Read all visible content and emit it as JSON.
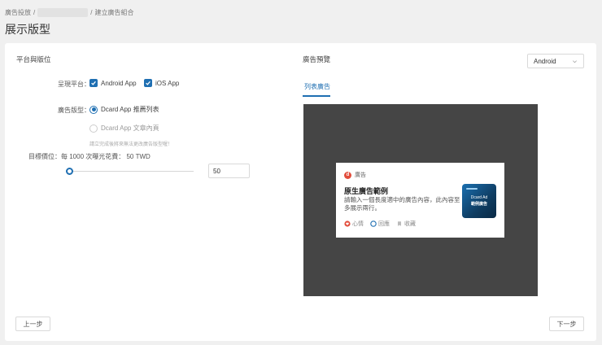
{
  "breadcrumb": {
    "first": "廣告投放",
    "sep1": "/",
    "sep2": "/",
    "current": "建立廣告組合"
  },
  "page_title": "展示版型",
  "left": {
    "section_title": "平台與版位",
    "platform_label": "呈現平台：",
    "platforms": [
      {
        "label": "Android App",
        "checked": true
      },
      {
        "label": "iOS App",
        "checked": true
      }
    ],
    "format_label": "廣告版型：",
    "formats": [
      {
        "label": "Dcard App 推薦列表",
        "selected": true
      },
      {
        "label": "Dcard App 文章內頁",
        "selected": false
      }
    ],
    "format_hint": "請立完成後將來無法更改廣告版型喔！",
    "bid_label": "目標價位：每 1000 次曝光花費： 50 TWD",
    "bid_value": "50",
    "bid_slider_fraction": 0.0
  },
  "right": {
    "section_title": "廣告預覽",
    "device_select": "Android",
    "tab": "列表廣告",
    "ad": {
      "brand_label": "廣告",
      "title": "原生廣告範例",
      "body": "請輸入一個長度適中的廣告內容，此內容至多展示兩行。",
      "actions": [
        "心情",
        "回應",
        "收藏"
      ],
      "thumb_line1": "Dcard Ad",
      "thumb_line2": "範例廣告"
    }
  },
  "footer": {
    "prev": "上一步",
    "next": "下一步"
  },
  "colors": {
    "accent": "#1f6fb2",
    "preview_bg": "#454545",
    "brand": "#e24d3c"
  }
}
